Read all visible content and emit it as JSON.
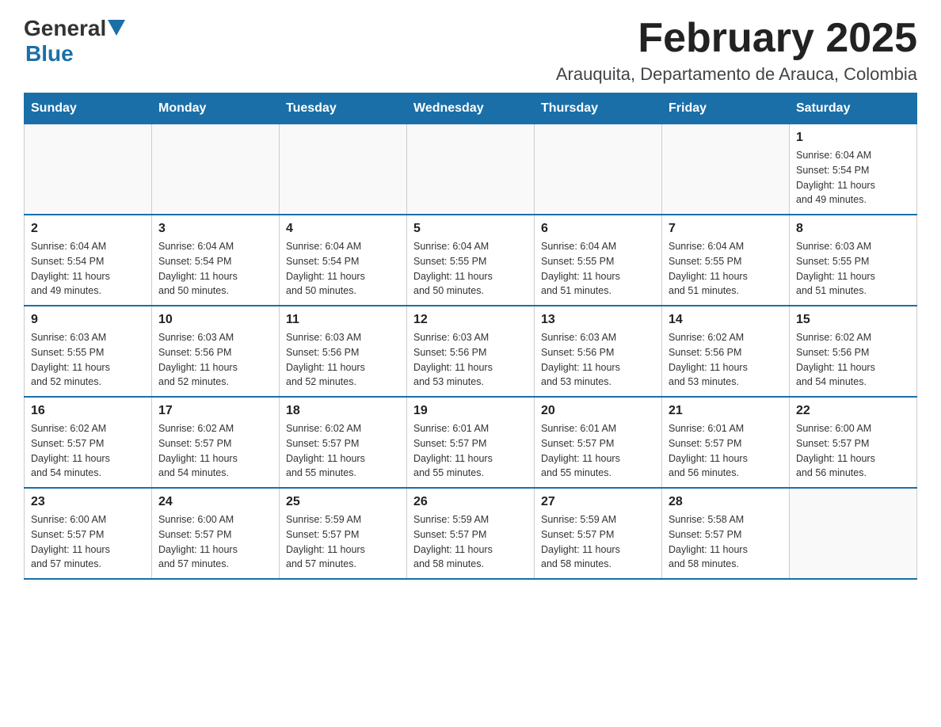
{
  "header": {
    "logo_general": "General",
    "logo_blue": "Blue",
    "title": "February 2025",
    "subtitle": "Arauquita, Departamento de Arauca, Colombia"
  },
  "weekdays": [
    "Sunday",
    "Monday",
    "Tuesday",
    "Wednesday",
    "Thursday",
    "Friday",
    "Saturday"
  ],
  "weeks": [
    [
      {
        "day": "",
        "info": ""
      },
      {
        "day": "",
        "info": ""
      },
      {
        "day": "",
        "info": ""
      },
      {
        "day": "",
        "info": ""
      },
      {
        "day": "",
        "info": ""
      },
      {
        "day": "",
        "info": ""
      },
      {
        "day": "1",
        "info": "Sunrise: 6:04 AM\nSunset: 5:54 PM\nDaylight: 11 hours\nand 49 minutes."
      }
    ],
    [
      {
        "day": "2",
        "info": "Sunrise: 6:04 AM\nSunset: 5:54 PM\nDaylight: 11 hours\nand 49 minutes."
      },
      {
        "day": "3",
        "info": "Sunrise: 6:04 AM\nSunset: 5:54 PM\nDaylight: 11 hours\nand 50 minutes."
      },
      {
        "day": "4",
        "info": "Sunrise: 6:04 AM\nSunset: 5:54 PM\nDaylight: 11 hours\nand 50 minutes."
      },
      {
        "day": "5",
        "info": "Sunrise: 6:04 AM\nSunset: 5:55 PM\nDaylight: 11 hours\nand 50 minutes."
      },
      {
        "day": "6",
        "info": "Sunrise: 6:04 AM\nSunset: 5:55 PM\nDaylight: 11 hours\nand 51 minutes."
      },
      {
        "day": "7",
        "info": "Sunrise: 6:04 AM\nSunset: 5:55 PM\nDaylight: 11 hours\nand 51 minutes."
      },
      {
        "day": "8",
        "info": "Sunrise: 6:03 AM\nSunset: 5:55 PM\nDaylight: 11 hours\nand 51 minutes."
      }
    ],
    [
      {
        "day": "9",
        "info": "Sunrise: 6:03 AM\nSunset: 5:55 PM\nDaylight: 11 hours\nand 52 minutes."
      },
      {
        "day": "10",
        "info": "Sunrise: 6:03 AM\nSunset: 5:56 PM\nDaylight: 11 hours\nand 52 minutes."
      },
      {
        "day": "11",
        "info": "Sunrise: 6:03 AM\nSunset: 5:56 PM\nDaylight: 11 hours\nand 52 minutes."
      },
      {
        "day": "12",
        "info": "Sunrise: 6:03 AM\nSunset: 5:56 PM\nDaylight: 11 hours\nand 53 minutes."
      },
      {
        "day": "13",
        "info": "Sunrise: 6:03 AM\nSunset: 5:56 PM\nDaylight: 11 hours\nand 53 minutes."
      },
      {
        "day": "14",
        "info": "Sunrise: 6:02 AM\nSunset: 5:56 PM\nDaylight: 11 hours\nand 53 minutes."
      },
      {
        "day": "15",
        "info": "Sunrise: 6:02 AM\nSunset: 5:56 PM\nDaylight: 11 hours\nand 54 minutes."
      }
    ],
    [
      {
        "day": "16",
        "info": "Sunrise: 6:02 AM\nSunset: 5:57 PM\nDaylight: 11 hours\nand 54 minutes."
      },
      {
        "day": "17",
        "info": "Sunrise: 6:02 AM\nSunset: 5:57 PM\nDaylight: 11 hours\nand 54 minutes."
      },
      {
        "day": "18",
        "info": "Sunrise: 6:02 AM\nSunset: 5:57 PM\nDaylight: 11 hours\nand 55 minutes."
      },
      {
        "day": "19",
        "info": "Sunrise: 6:01 AM\nSunset: 5:57 PM\nDaylight: 11 hours\nand 55 minutes."
      },
      {
        "day": "20",
        "info": "Sunrise: 6:01 AM\nSunset: 5:57 PM\nDaylight: 11 hours\nand 55 minutes."
      },
      {
        "day": "21",
        "info": "Sunrise: 6:01 AM\nSunset: 5:57 PM\nDaylight: 11 hours\nand 56 minutes."
      },
      {
        "day": "22",
        "info": "Sunrise: 6:00 AM\nSunset: 5:57 PM\nDaylight: 11 hours\nand 56 minutes."
      }
    ],
    [
      {
        "day": "23",
        "info": "Sunrise: 6:00 AM\nSunset: 5:57 PM\nDaylight: 11 hours\nand 57 minutes."
      },
      {
        "day": "24",
        "info": "Sunrise: 6:00 AM\nSunset: 5:57 PM\nDaylight: 11 hours\nand 57 minutes."
      },
      {
        "day": "25",
        "info": "Sunrise: 5:59 AM\nSunset: 5:57 PM\nDaylight: 11 hours\nand 57 minutes."
      },
      {
        "day": "26",
        "info": "Sunrise: 5:59 AM\nSunset: 5:57 PM\nDaylight: 11 hours\nand 58 minutes."
      },
      {
        "day": "27",
        "info": "Sunrise: 5:59 AM\nSunset: 5:57 PM\nDaylight: 11 hours\nand 58 minutes."
      },
      {
        "day": "28",
        "info": "Sunrise: 5:58 AM\nSunset: 5:57 PM\nDaylight: 11 hours\nand 58 minutes."
      },
      {
        "day": "",
        "info": ""
      }
    ]
  ]
}
